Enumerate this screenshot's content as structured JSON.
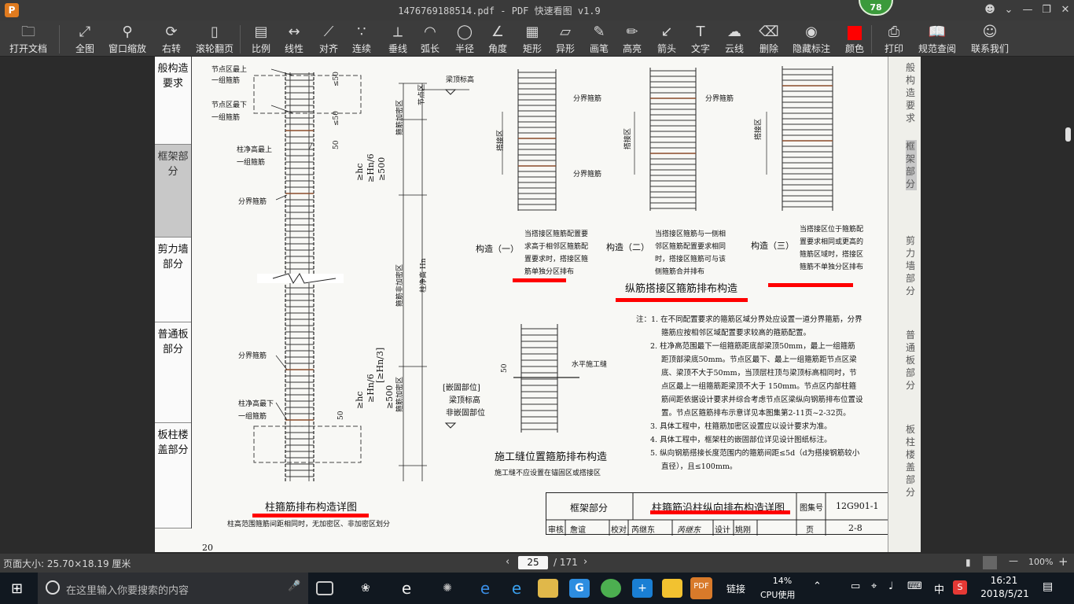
{
  "window": {
    "title": "1476769188514.pdf - PDF 快速看图 v1.9",
    "badge": "78",
    "logo_letter": "P"
  },
  "toolbar": {
    "items": [
      {
        "label": "打开文档",
        "icon": "folder-icon"
      },
      {
        "label": "全图",
        "icon": "fit-icon"
      },
      {
        "label": "窗口缩放",
        "icon": "zoom-icon"
      },
      {
        "label": "右转",
        "icon": "rotate-icon"
      },
      {
        "label": "滚轮翻页",
        "icon": "mouse-icon"
      },
      {
        "label": "比例",
        "icon": "scale-icon"
      },
      {
        "label": "线性",
        "icon": "linear-icon"
      },
      {
        "label": "对齐",
        "icon": "align-icon"
      },
      {
        "label": "连续",
        "icon": "continuous-icon"
      },
      {
        "label": "垂线",
        "icon": "perpendicular-icon"
      },
      {
        "label": "弧长",
        "icon": "arc-icon"
      },
      {
        "label": "半径",
        "icon": "radius-icon"
      },
      {
        "label": "角度",
        "icon": "angle-icon"
      },
      {
        "label": "矩形",
        "icon": "rectangle-icon"
      },
      {
        "label": "异形",
        "icon": "polygon-icon"
      },
      {
        "label": "画笔",
        "icon": "pen-icon"
      },
      {
        "label": "高亮",
        "icon": "highlight-icon"
      },
      {
        "label": "箭头",
        "icon": "arrow-icon"
      },
      {
        "label": "文字",
        "icon": "text-icon"
      },
      {
        "label": "云线",
        "icon": "cloud-icon"
      },
      {
        "label": "删除",
        "icon": "eraser-icon"
      },
      {
        "label": "隐藏标注",
        "icon": "eye-icon"
      },
      {
        "label": "颜色",
        "icon": "color-icon",
        "color": "#ff0000"
      },
      {
        "label": "打印",
        "icon": "printer-icon"
      },
      {
        "label": "规范查阅",
        "icon": "book-icon"
      },
      {
        "label": "联系我们",
        "icon": "contact-icon"
      }
    ]
  },
  "document": {
    "left_tabs": [
      {
        "text": "般构造要求"
      },
      {
        "text": "框架部分",
        "active": true
      },
      {
        "text": "剪力墙部分"
      },
      {
        "text": "普通板部分"
      },
      {
        "text": "板柱楼盖部分"
      }
    ],
    "labels": {
      "node_top": "节点区最上",
      "node_top2": "一组箍筋",
      "node_bottom": "节点区最下",
      "node_bottom2": "一组箍筋",
      "col_top": "柱净高最上",
      "col_top2": "一组箍筋",
      "divider1": "分界箍筋",
      "divider2": "分界箍筋",
      "col_bottom": "柱净高最下",
      "col_bottom2": "一组箍筋",
      "beam_top": "梁顶标高",
      "node_zone": "节点区",
      "hoop_dense": "箍筋加密区",
      "hoop_nondense": "箍筋非加密区",
      "col_height": "柱净高 Hn",
      "hc1": "≥hc",
      "hn6_1": "≥Hn/6",
      "gt500_1": "≥500",
      "hc2": "≥hc",
      "hn6_2": "≥Hn/6",
      "hn3": "[≥Hn/3]",
      "gt500_2": "≥500",
      "d50_a": "≤50",
      "d50_b": "≤50",
      "d50_c": "50",
      "d50_d": "50",
      "d50_e": "50",
      "embed1": "[嵌固部位]",
      "embed2": "梁顶标高",
      "embed3": "非嵌固部位",
      "divider_a": "分界箍筋",
      "divider_b": "分界箍筋",
      "divider_c": "分界箍筋",
      "lap1": "搭接区",
      "lap2": "搭接区",
      "lap3": "搭接区",
      "c1_title": "构造（一）",
      "c2_title": "构造（二）",
      "c3_title": "构造（三）",
      "c1_d1": "当搭接区箍筋配置要",
      "c1_d2": "求高于相邻区箍筋配",
      "c1_d3": "置要求时，搭接区箍",
      "c1_d4": "筋单独分区排布",
      "c2_d1": "当搭接区箍筋与一侧相",
      "c2_d2": "邻区箍筋配置要求相同",
      "c2_d3": "时，搭接区箍筋可与该",
      "c2_d4": "侧箍筋合并排布",
      "c3_d1": "当搭接区位于箍筋配",
      "c3_d2": "置要求相同或更高的",
      "c3_d3": "箍筋区域时，搭接区",
      "c3_d4": "箍筋不单独分区排布",
      "lap_title": "纵筋搭接区箍筋排布构造",
      "joint_label": "水平施工缝",
      "joint_title": "施工缝位置箍筋排布构造",
      "joint_sub": "施工缝不应设置在锚固区或搭接区",
      "main_title": "柱箍筋排布构造详图",
      "main_sub": "柱高范围箍筋间距相同时，无加密区、非加密区划分",
      "page_no": "20"
    },
    "notes": [
      "注：1. 在不同配置要求的箍筋区域分界处应设置一道分界箍筋，分界",
      "箍筋应按相邻区域配置要求较高的箍筋配置。",
      "2. 柱净高范围最下一组箍筋距底部梁顶50mm，最上一组箍筋",
      "距顶部梁底50mm。节点区最下、最上一组箍筋距节点区梁",
      "底、梁顶不大于50mm，当顶层柱顶与梁顶标高相同时，节",
      "点区最上一组箍筋距梁顶不大于 150mm。节点区内部柱箍",
      "筋间距依据设计要求并综合考虑节点区梁纵向钢筋排布位置设",
      "置。节点区箍筋排布示意详见本图集第2-11页~2-32页。",
      "3. 具体工程中，柱箍筋加密区设置应以设计要求为准。",
      "4. 具体工程中，框架柱的嵌固部位详见设计图纸标注。",
      "5. 纵向钢筋搭接长度范围内的箍筋间距≤5d（d为搭接钢筋较小",
      "直径），且≤100mm。"
    ],
    "title_block": {
      "section": "框架部分",
      "title": "柱箍筋沿柱纵向排布构造详图",
      "atlas_label": "图集号",
      "atlas_no": "12G901-1",
      "review": "审核",
      "review_name": "詹谊",
      "check": "校对",
      "check_name": "芮继东",
      "design": "设计",
      "design_name": "姚刚",
      "page_label": "页",
      "page_no": "2-8"
    },
    "right_strip": [
      "般构造要求",
      "框架部分",
      "剪力墙部分",
      "普通板部分",
      "板柱楼盖部分"
    ]
  },
  "status": {
    "page_size": "页面大小: 25.70×18.19 厘米",
    "current_page": "25",
    "total_pages": "/ 171",
    "zoom": "100%"
  },
  "taskbar": {
    "search_placeholder": "在这里输入你要搜索的内容",
    "link_label": "链接",
    "cpu_value": "14%",
    "cpu_label": "CPU使用",
    "ime": "中",
    "time": "16:21",
    "date": "2018/5/21"
  }
}
